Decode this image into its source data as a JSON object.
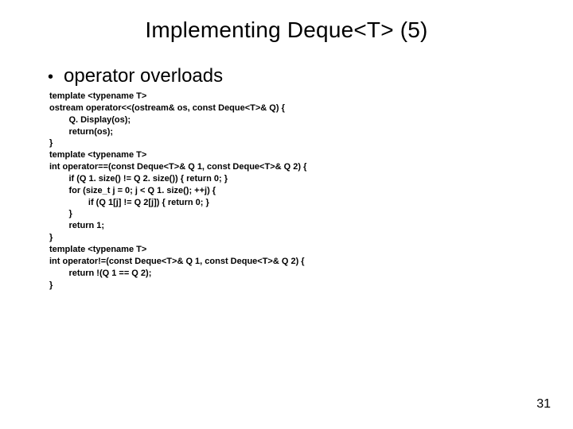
{
  "title": "Implementing Deque<T> (5)",
  "bullet": "operator overloads",
  "code": "template <typename T>\nostream operator<<(ostream& os, const Deque<T>& Q) {\n        Q. Display(os);\n        return(os);\n}\ntemplate <typename T>\nint operator==(const Deque<T>& Q 1, const Deque<T>& Q 2) {\n        if (Q 1. size() != Q 2. size()) { return 0; }\n        for (size_t j = 0; j < Q 1. size(); ++j) {\n                if (Q 1[j] != Q 2[j]) { return 0; }\n        }\n        return 1;\n}\ntemplate <typename T>\nint operator!=(const Deque<T>& Q 1, const Deque<T>& Q 2) {\n        return !(Q 1 == Q 2);\n}",
  "page_number": "31"
}
